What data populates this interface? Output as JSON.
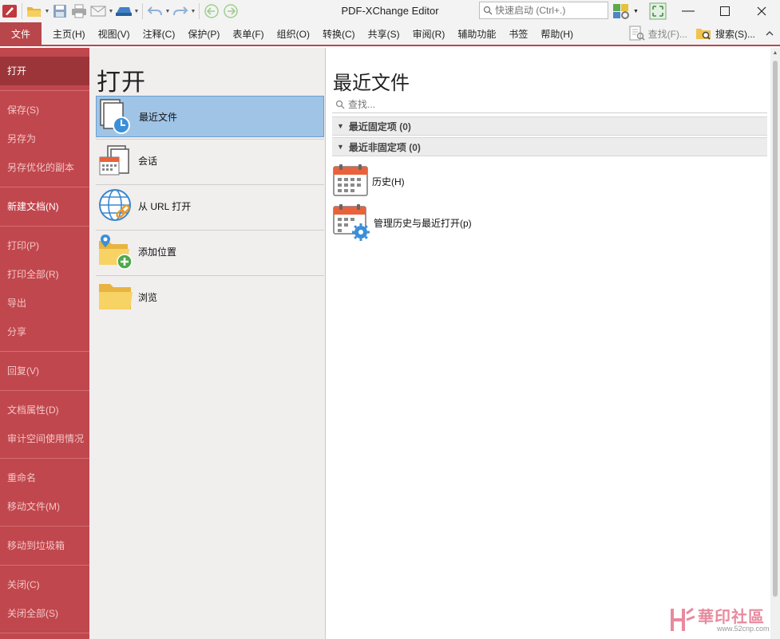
{
  "window": {
    "title": "PDF-XChange Editor",
    "quick_launch_placeholder": "快速启动 (Ctrl+.)"
  },
  "menubar": {
    "file": "文件",
    "items": [
      "主页(H)",
      "视图(V)",
      "注释(C)",
      "保护(P)",
      "表单(F)",
      "组织(O)",
      "转换(C)",
      "共享(S)",
      "审阅(R)",
      "辅助功能",
      "书签",
      "帮助(H)"
    ],
    "find": "查找(F)...",
    "search": "搜索(S)..."
  },
  "leftnav": {
    "items": [
      "打开",
      "保存(S)",
      "另存为",
      "另存优化的副本",
      "新建文档(N)",
      "打印(P)",
      "打印全部(R)",
      "导出",
      "分享",
      "回复(V)",
      "文档属性(D)",
      "审计空间使用情况",
      "重命名",
      "移动文件(M)",
      "移动到垃圾箱",
      "关闭(C)",
      "关闭全部(S)"
    ]
  },
  "open_pane": {
    "title": "打开",
    "options": [
      "最近文件",
      "会话",
      "从 URL 打开",
      "添加位置",
      "浏览"
    ]
  },
  "recent_pane": {
    "title": "最近文件",
    "search_placeholder": "查找...",
    "pinned_group": "最近固定项 (0)",
    "unpinned_group": "最近非固定项 (0)",
    "history": "历史(H)",
    "manage_history": "管理历史与最近打开(p)"
  },
  "watermark": {
    "text": "華印社區",
    "url": "www.52cnp.com"
  },
  "colors": {
    "accent": "#b8474b",
    "nav_bg": "#c0474d",
    "nav_active": "#9c3539",
    "selection": "#9fc4e6"
  }
}
